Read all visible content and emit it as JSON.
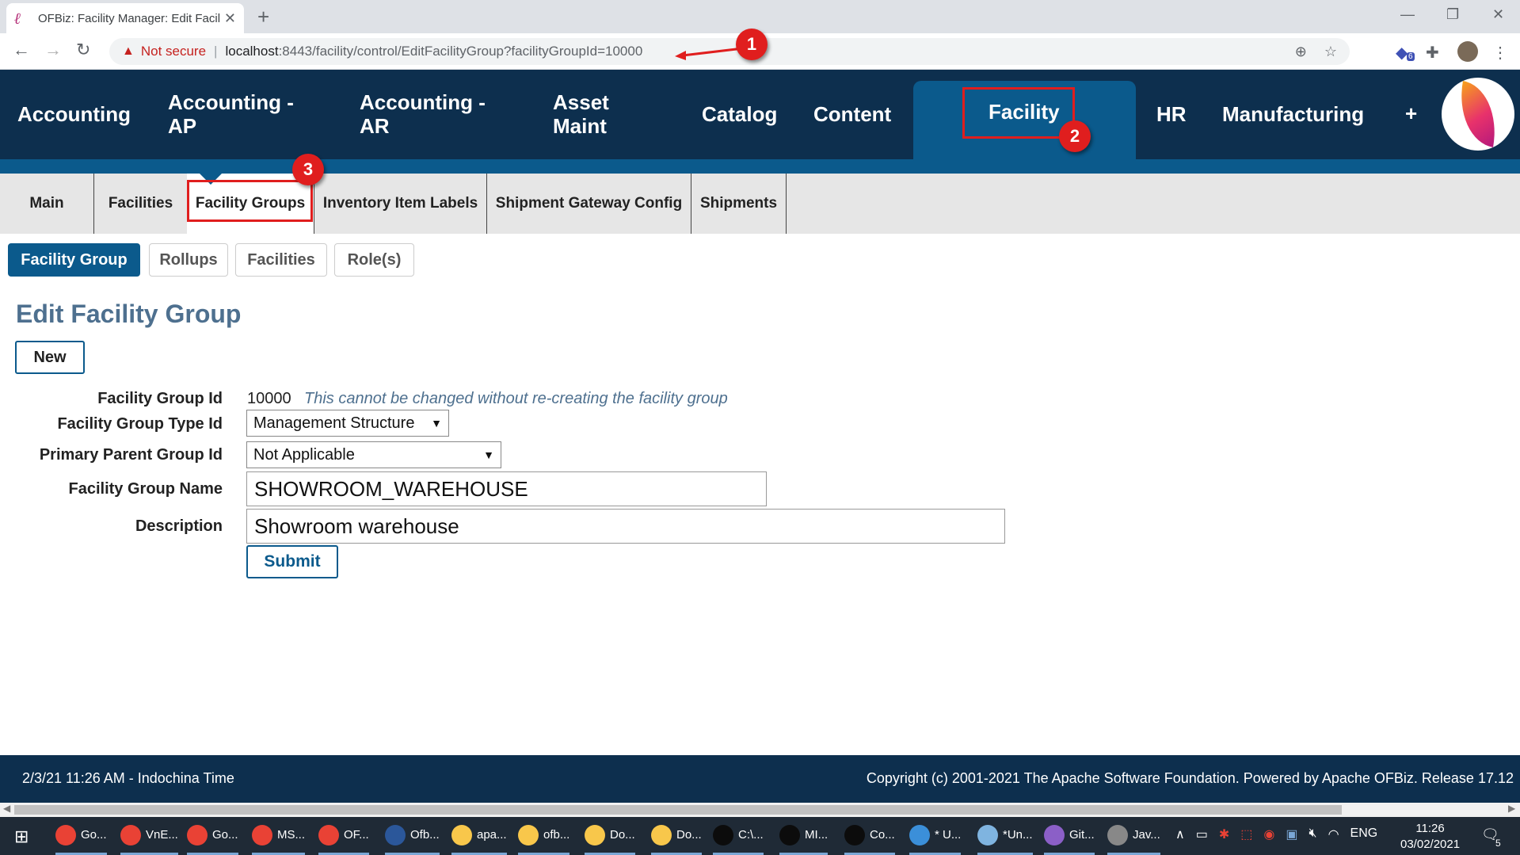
{
  "browser": {
    "tab_title": "OFBiz: Facility Manager: Edit Facil",
    "not_secure": "Not secure",
    "url_host": "localhost",
    "url_path": ":8443/facility/control/EditFacilityGroup?facilityGroupId=10000",
    "ext_badge": "6"
  },
  "annotations": [
    "1",
    "2",
    "3"
  ],
  "app_nav": {
    "items": [
      "Accounting",
      "Accounting - AP",
      "Accounting - AR",
      "Asset Maint",
      "Catalog",
      "Content",
      "Facility",
      "HR",
      "Manufacturing",
      "+"
    ],
    "active": "Facility"
  },
  "sub_tabs": {
    "items": [
      "Main",
      "Facilities",
      "Facility Groups",
      "Inventory Item Labels",
      "Shipment Gateway Config",
      "Shipments"
    ],
    "active": "Facility Groups"
  },
  "button_bar": {
    "items": [
      "Facility Group",
      "Rollups",
      "Facilities",
      "Role(s)"
    ],
    "active": "Facility Group"
  },
  "page": {
    "title": "Edit Facility Group",
    "new_button": "New"
  },
  "form": {
    "group_id_label": "Facility Group Id",
    "group_id_value": "10000",
    "group_id_note": "This cannot be changed without re-creating the facility group",
    "type_label": "Facility Group Type Id",
    "type_value": "Management Structure",
    "parent_label": "Primary Parent Group Id",
    "parent_value": "Not Applicable",
    "name_label": "Facility Group Name",
    "name_value": "SHOWROOM_WAREHOUSE",
    "desc_label": "Description",
    "desc_value": "Showroom warehouse",
    "submit": "Submit"
  },
  "footer": {
    "left": "2/3/21 11:26 AM - Indochina Time",
    "right": "Copyright (c) 2001-2021 The Apache Software Foundation. Powered by Apache OFBiz. Release 17.12"
  },
  "taskbar": {
    "items": [
      {
        "label": "Go...",
        "color": "#e94235"
      },
      {
        "label": "VnE...",
        "color": "#e94235"
      },
      {
        "label": "Go...",
        "color": "#e94235"
      },
      {
        "label": "MS...",
        "color": "#e94235"
      },
      {
        "label": "OF...",
        "color": "#e94235"
      },
      {
        "label": "Ofb...",
        "color": "#2b579a"
      },
      {
        "label": "apa...",
        "color": "#f8c74b"
      },
      {
        "label": "ofb...",
        "color": "#f8c74b"
      },
      {
        "label": "Do...",
        "color": "#f8c74b"
      },
      {
        "label": "Do...",
        "color": "#f8c74b"
      },
      {
        "label": "C:\\...",
        "color": "#0c0c0c"
      },
      {
        "label": "MI...",
        "color": "#0c0c0c"
      },
      {
        "label": "Co...",
        "color": "#0c0c0c"
      },
      {
        "label": "* U...",
        "color": "#3b8fd9"
      },
      {
        "label": "*Un...",
        "color": "#7fb4e0"
      },
      {
        "label": "Git...",
        "color": "#8b5fc7"
      },
      {
        "label": "Jav...",
        "color": "#888888"
      }
    ],
    "lang": "ENG",
    "time": "11:26",
    "date": "03/02/2021",
    "notif_count": "5"
  },
  "colors": {
    "nav_bg": "#0d2f4e",
    "nav_active": "#0b5a8c",
    "annotation_red": "#e01e1e",
    "title_color": "#4e708f"
  }
}
